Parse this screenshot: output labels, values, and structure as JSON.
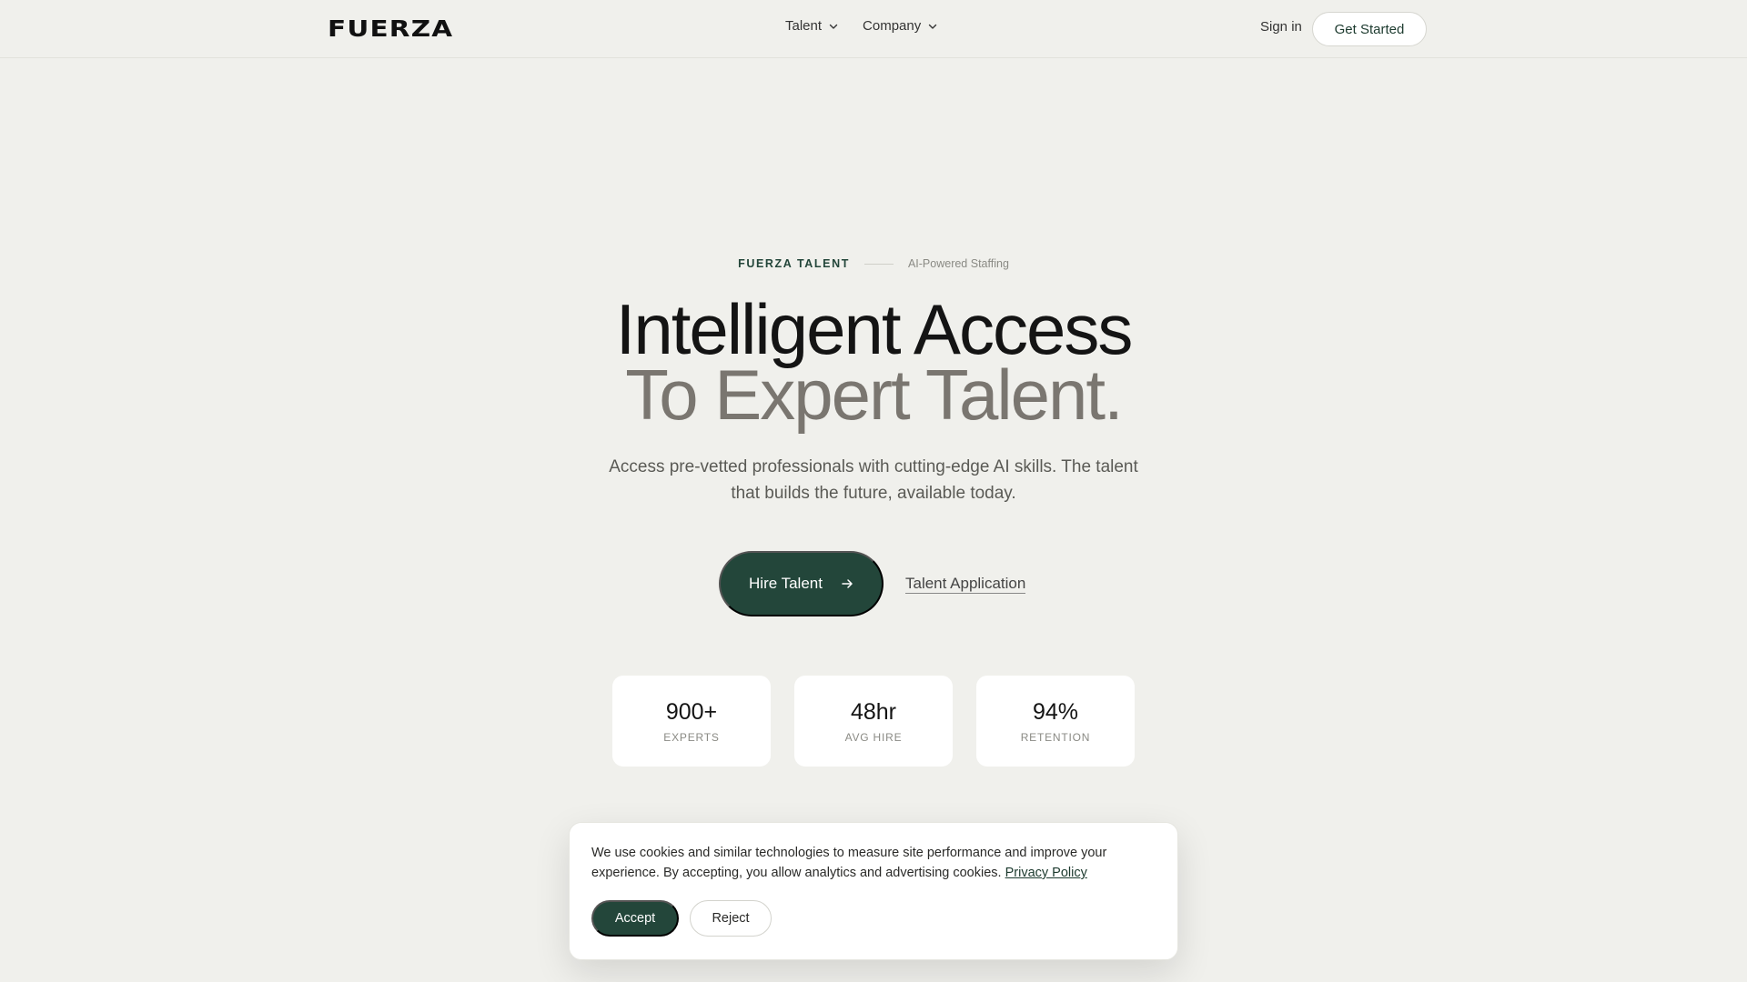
{
  "header": {
    "logo": "FUERZA",
    "nav": [
      {
        "label": "Talent",
        "icon": "chevron-down-icon"
      },
      {
        "label": "Company",
        "icon": "chevron-down-icon"
      }
    ],
    "sign_in": "Sign in",
    "get_started": "Get Started"
  },
  "hero": {
    "eyebrow_brand": "FUERZA TALENT",
    "eyebrow_tag": "AI-Powered Staffing",
    "headline_line1": "Intelligent Access",
    "headline_line2": "To Expert Talent.",
    "subtitle": "Access pre-vetted professionals with cutting-edge AI skills. The talent that builds the future, available today.",
    "primary_cta": "Hire Talent",
    "primary_cta_icon": "arrow-right-icon",
    "secondary_cta": "Talent Application"
  },
  "stats": [
    {
      "value": "900+",
      "label": "EXPERTS"
    },
    {
      "value": "48hr",
      "label": "AVG HIRE"
    },
    {
      "value": "94%",
      "label": "RETENTION"
    }
  ],
  "cookie_banner": {
    "text": "We use cookies and similar technologies to measure site performance and improve your experience. By accepting, you allow analytics and advertising cookies.",
    "privacy_link": "Privacy Policy",
    "accept": "Accept",
    "reject": "Reject"
  },
  "colors": {
    "background": "#f0f0ec",
    "accent_green": "#23463a",
    "headline_secondary": "#7a7670"
  }
}
